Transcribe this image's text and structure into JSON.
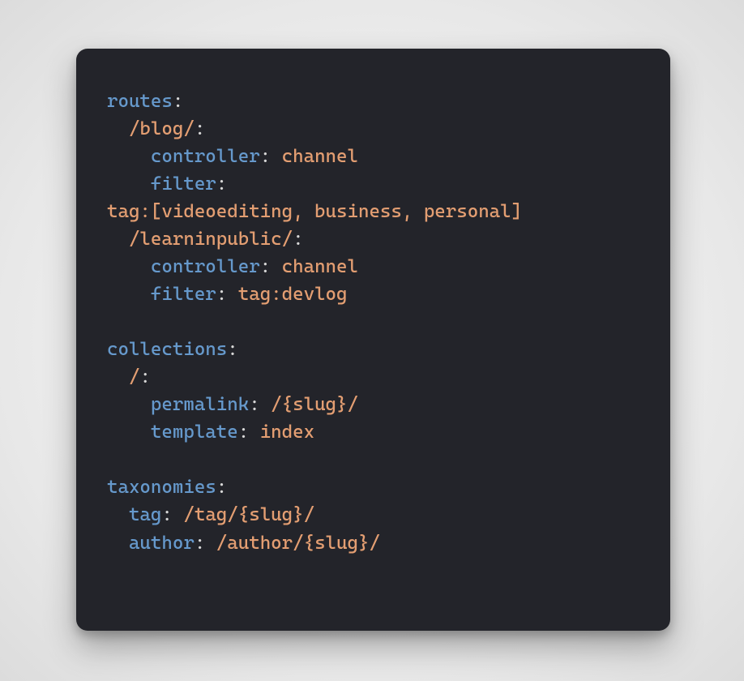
{
  "code": {
    "routesKey": "routes",
    "blogPath": "/blog/",
    "controllerKey": "controller",
    "channelValue": "channel",
    "filterKey": "filter",
    "blogFilterValue": "tag:[videoediting, business, personal]",
    "learnPath": "/learninpublic/",
    "learnFilterValue": "tag:devlog",
    "collectionsKey": "collections",
    "rootPath": "/",
    "permalinkKey": "permalink",
    "permalinkValue": "/{slug}/",
    "templateKey": "template",
    "templateValue": "index",
    "taxonomiesKey": "taxonomies",
    "tagKey": "tag",
    "tagValue": "/tag/{slug}/",
    "authorKey": "author",
    "authorValue": "/author/{slug}/"
  }
}
